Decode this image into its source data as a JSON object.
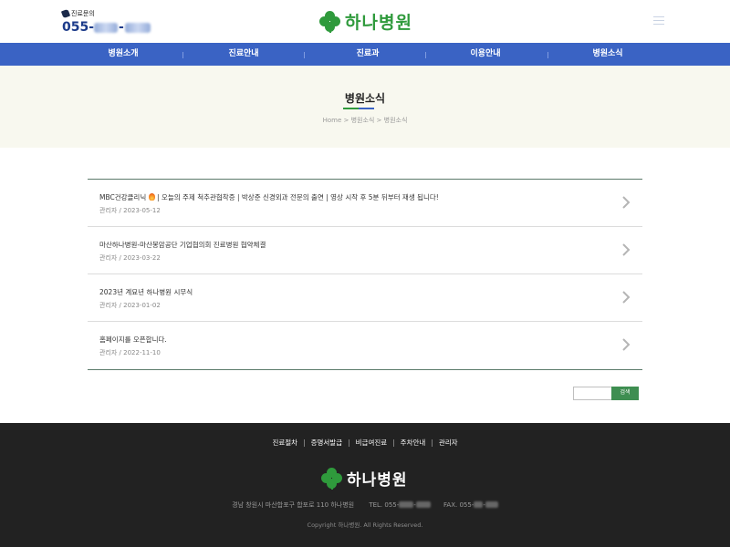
{
  "header": {
    "contact_label": "진료문의",
    "contact_prefix": "055-",
    "contact_sep": "-",
    "logo_text": "하나병원",
    "menu_icon": "hamburger-icon"
  },
  "nav": {
    "items": [
      "병원소개",
      "진료안내",
      "진료과",
      "이용안내",
      "병원소식"
    ]
  },
  "banner": {
    "title": "병원소식",
    "breadcrumb": "Home > 병원소식 > 병원소식",
    "bar_colors": [
      "#2f9a3c",
      "#3a63c4"
    ]
  },
  "posts": [
    {
      "title_before_icon": "MBC건강클리닉",
      "icon": "fire-icon",
      "title_after_icon": " | 오늘의 주제 척추관협착증 | 박상준 신경외과 전문의 출연 | 영상 시작 후 5분 뒤부터 재생 됩니다!",
      "author": "관리자",
      "date": "2023-05-12"
    },
    {
      "title": "마산하나병원-마산봉암공단 기업협의회 진료병원 협약체결",
      "author": "관리자",
      "date": "2023-03-22"
    },
    {
      "title": "2023년 계묘년 하나병원 시무식",
      "author": "관리자",
      "date": "2023-01-02"
    },
    {
      "title": "홈페이지를 오픈합니다.",
      "author": "관리자",
      "date": "2022-11-10"
    }
  ],
  "meta_sep": " / ",
  "search": {
    "value": "",
    "button_label": "검색"
  },
  "footer": {
    "links": [
      "진료절차",
      "증명서발급",
      "비급여진료",
      "주차안내",
      "관리자"
    ],
    "logo_text": "하나병원",
    "address": "경남 창원시 마산합포구 합포로 110 하나병원",
    "tel_label": "TEL. 055-",
    "fax_label": "FAX. 055-",
    "copyright": "Copyright 하나병원. All Rights Reserved."
  },
  "colors": {
    "nav_bg": "#3a63c4",
    "brand_green": "#2f9a3c",
    "footer_bg": "#222222",
    "search_btn": "#3e8e51"
  }
}
